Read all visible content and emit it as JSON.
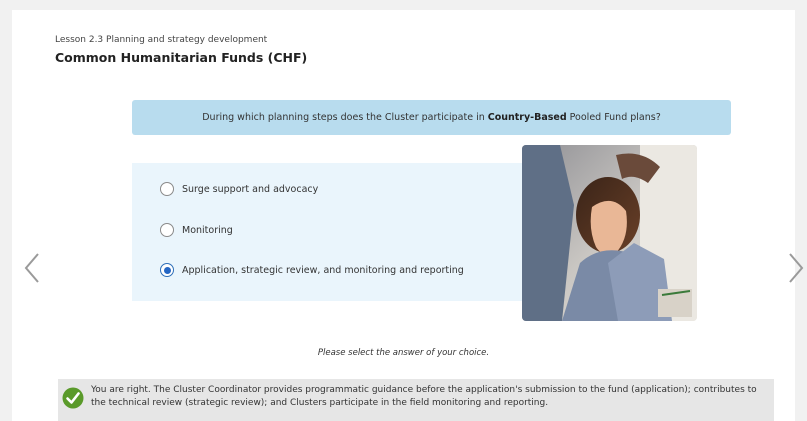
{
  "lesson": {
    "label": "Lesson 2.3  Planning and strategy development"
  },
  "course": {
    "title": "Common Humanitarian Funds (CHF)"
  },
  "question": {
    "prefix": "During which planning steps does the Cluster participate in",
    "emphasis": "Country-Based",
    "suffix": "Pooled Fund plans?"
  },
  "options": [
    {
      "label": "Surge support and advocacy",
      "selected": false
    },
    {
      "label": "Monitoring",
      "selected": false
    },
    {
      "label": "Application, strategic review, and monitoring and reporting",
      "selected": true
    }
  ],
  "instruction": "Please select the answer of your choice.",
  "feedback": {
    "text": "You are right. The Cluster Coordinator provides programmatic guidance before the application's submission to the fund (application); contributes to the technical review (strategic review); and Clusters participate in the field monitoring and reporting.",
    "icon": "check-icon",
    "icon_color": "#5a9a2a"
  },
  "nav": {
    "prev_icon": "chevron-left-icon",
    "next_icon": "chevron-right-icon"
  },
  "colors": {
    "question_bg": "#b8dcee",
    "options_bg": "#eaf5fc",
    "selected_radio": "#2566c4",
    "feedback_bg": "#e6e6e6"
  }
}
